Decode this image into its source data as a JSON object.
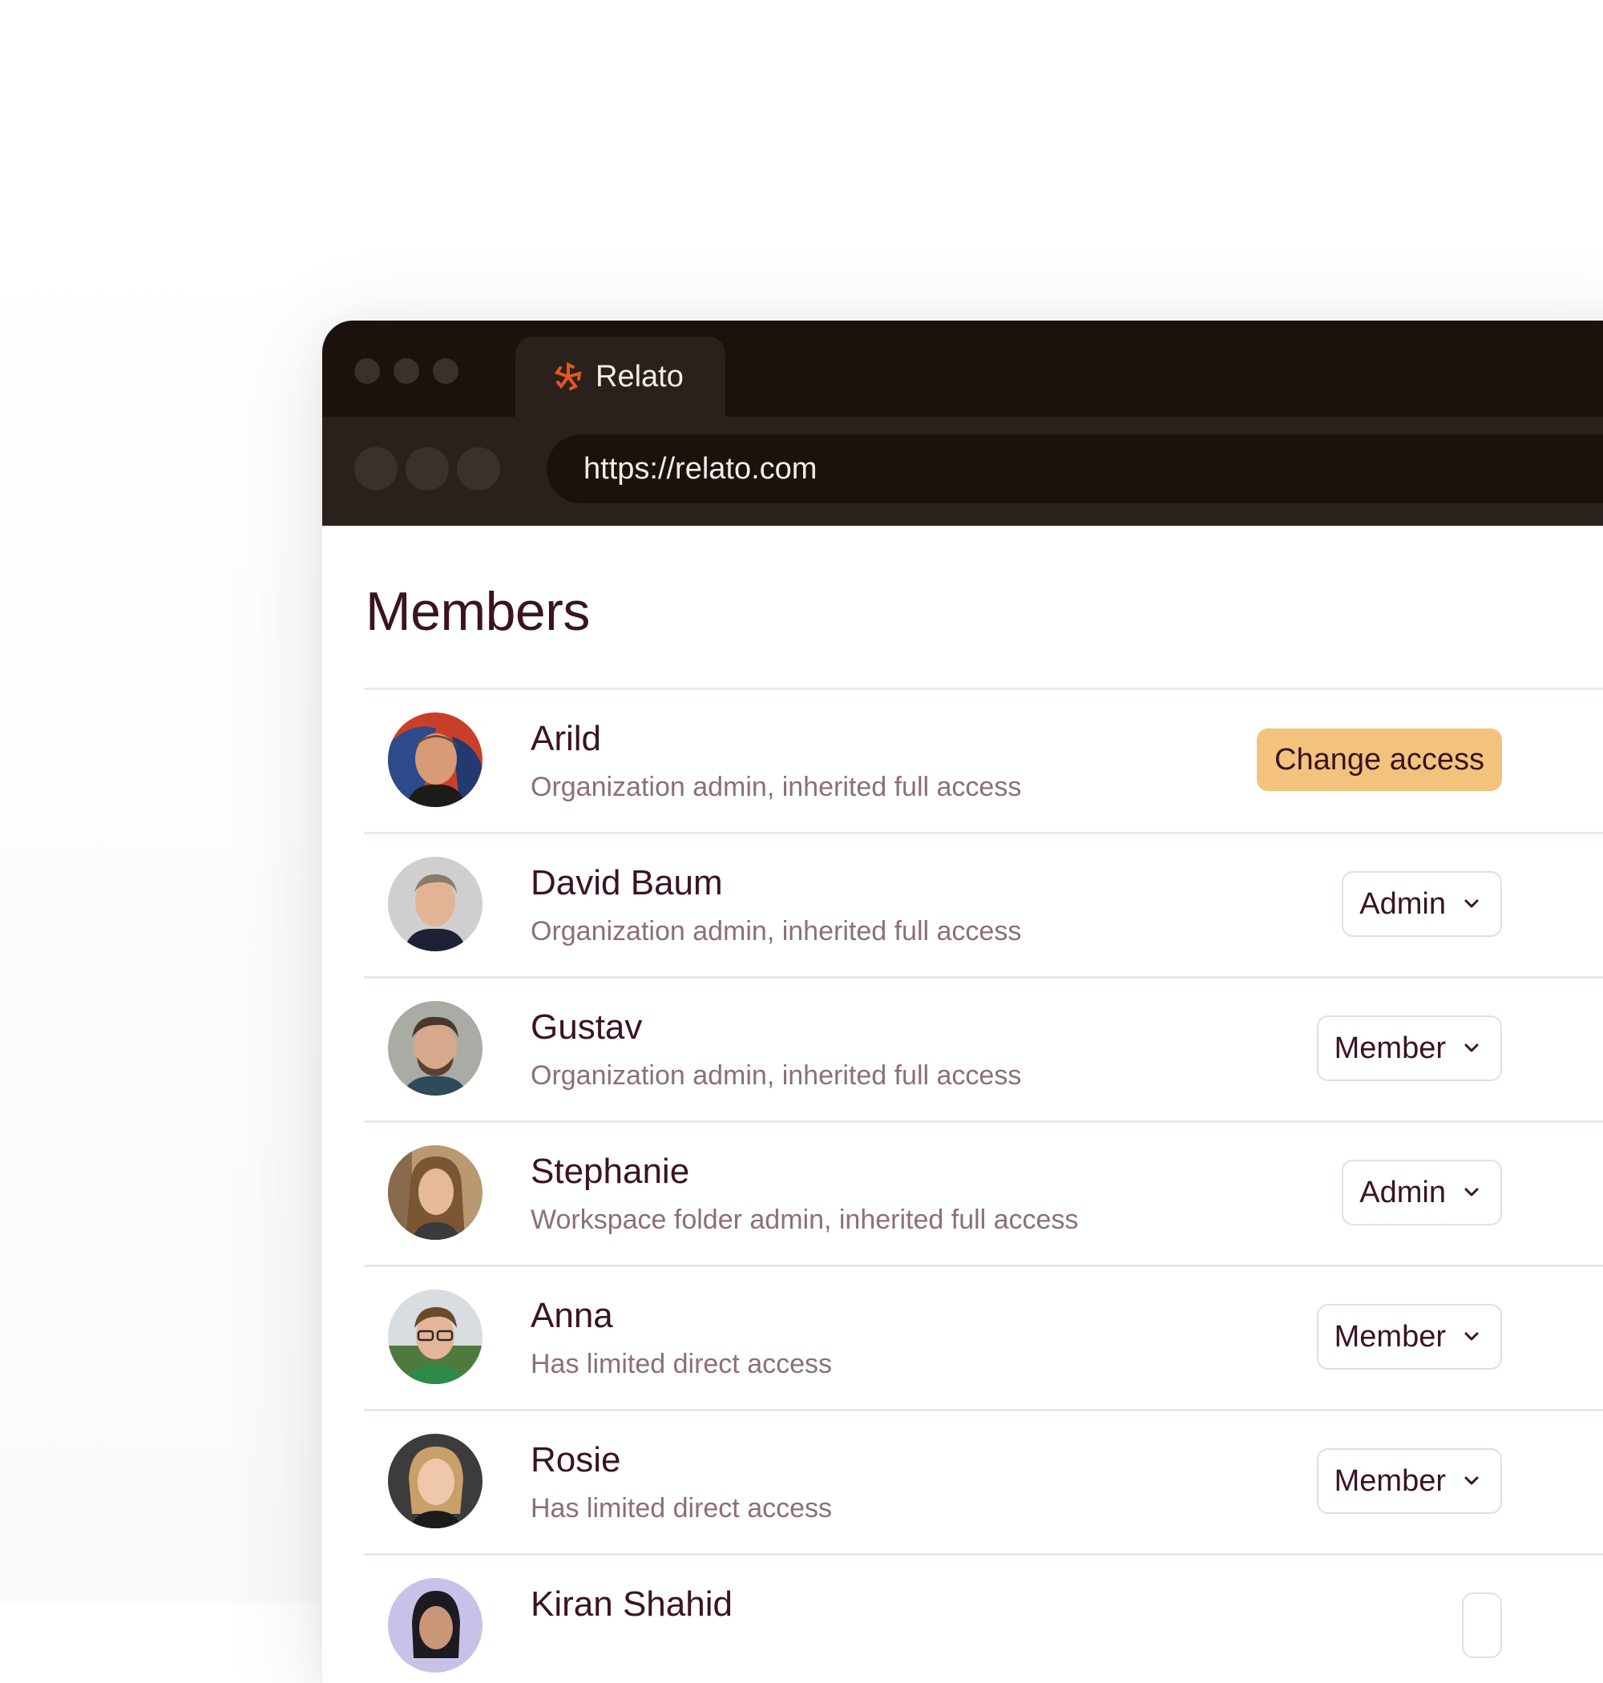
{
  "browser": {
    "tab_title": "Relato",
    "url": "https://relato.com"
  },
  "page": {
    "title": "Members"
  },
  "colors": {
    "accent": "#f3c37e",
    "brand_logo": "#e2571f",
    "text_primary": "#3a1324",
    "text_secondary": "#8c6f78",
    "chrome_dark": "#1b120e"
  },
  "members": [
    {
      "name": "Arild",
      "description": "Organization admin, inherited full access",
      "action": "Change access"
    },
    {
      "name": "David Baum",
      "description": "Organization admin, inherited full access",
      "role": "Admin"
    },
    {
      "name": "Gustav",
      "description": "Organization admin, inherited full access",
      "role": "Member"
    },
    {
      "name": "Stephanie",
      "description": "Workspace folder admin, inherited full access",
      "role": "Admin"
    },
    {
      "name": "Anna",
      "description": "Has limited direct access",
      "role": "Member"
    },
    {
      "name": "Rosie",
      "description": "Has limited direct access",
      "role": "Member"
    },
    {
      "name": "Kiran Shahid",
      "description": "",
      "role": ""
    }
  ]
}
